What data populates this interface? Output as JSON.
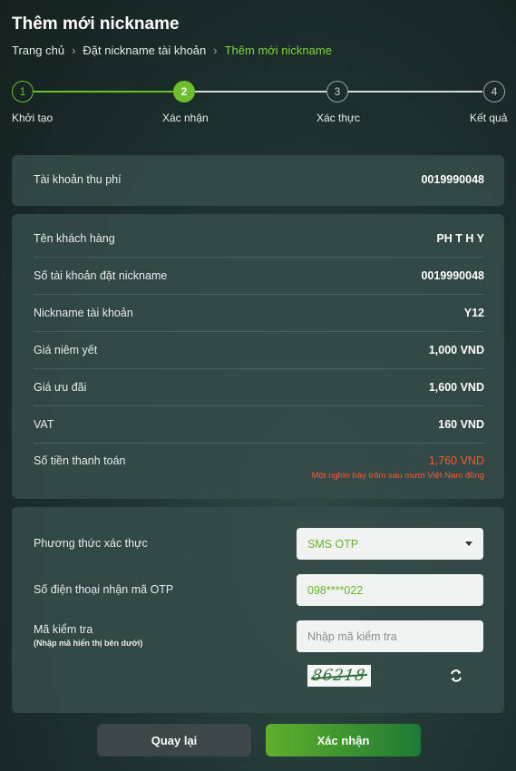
{
  "page": {
    "title": "Thêm mới nickname"
  },
  "breadcrumb": [
    "Trang chủ",
    "Đặt nickname tài khoản",
    "Thêm mới nickname"
  ],
  "steps": [
    {
      "number": "1",
      "label": "Khởi tạo",
      "state": "done"
    },
    {
      "number": "2",
      "label": "Xác nhận",
      "state": "active"
    },
    {
      "number": "3",
      "label": "Xác thực",
      "state": "pending"
    },
    {
      "number": "4",
      "label": "Kết quả",
      "state": "pending"
    }
  ],
  "fee_account": {
    "label": "Tài khoản thu phí",
    "value": "0019990048"
  },
  "details": [
    {
      "label": "Tên khách hàng",
      "value": "PH T H Y"
    },
    {
      "label": "Số tài khoản đặt nickname",
      "value": "0019990048"
    },
    {
      "label": "Nickname tài khoản",
      "value": "Y12"
    },
    {
      "label": "Giá niêm yết",
      "value": "1,000 VND"
    },
    {
      "label": "Giá ưu đãi",
      "value": "1,600 VND"
    },
    {
      "label": "VAT",
      "value": "160 VND"
    }
  ],
  "payment": {
    "label": "Số tiền thanh toán",
    "value": "1,760 VND",
    "in_words": "Một nghìn bảy trăm sáu mươi Việt Nam đồng"
  },
  "verification": {
    "method_label": "Phương thức xác thực",
    "method_value": "SMS OTP",
    "phone_label": "Số điện thoại nhận mã OTP",
    "phone_value": "098****022",
    "captcha_label": "Mã kiểm tra",
    "captcha_hint": "(Nhập mã hiển thị bên dưới)",
    "captcha_placeholder": "Nhập mã kiểm tra",
    "captcha_text": "86218"
  },
  "buttons": {
    "back": "Quay lại",
    "confirm": "Xác nhận"
  },
  "colors": {
    "accent": "#6cbf2d",
    "danger": "#ff5a2a",
    "pending": "#9aa7a5"
  }
}
